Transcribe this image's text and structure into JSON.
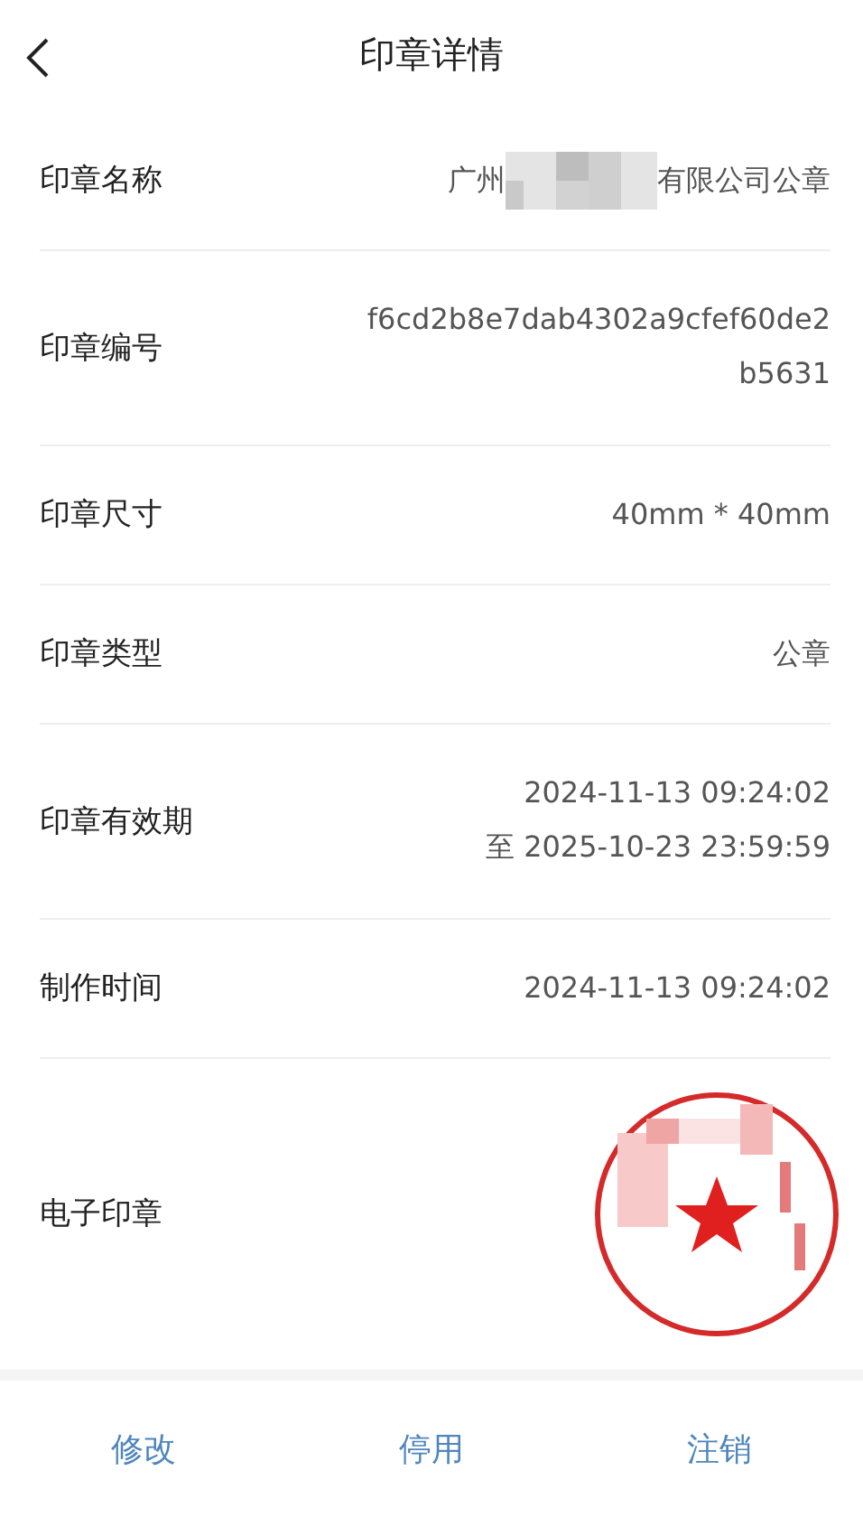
{
  "header": {
    "title": "印章详情"
  },
  "rows": [
    {
      "kind": "name",
      "label": "印章名称",
      "value_start": "广州",
      "value_end": "有限公司公章"
    },
    {
      "kind": "text",
      "label": "印章编号",
      "value": "f6cd2b8e7dab4302a9cfef60de2b5631"
    },
    {
      "kind": "text",
      "label": "印章尺寸",
      "value": "40mm * 40mm"
    },
    {
      "kind": "text",
      "label": "印章类型",
      "value": "公章"
    },
    {
      "kind": "lines",
      "label": "印章有效期",
      "lines": [
        "2024-11-13 09:24:02",
        "至 2025-10-23 23:59:59"
      ]
    },
    {
      "kind": "text",
      "label": "制作时间",
      "value": "2024-11-13 09:24:02"
    },
    {
      "kind": "seal",
      "label": "电子印章"
    }
  ],
  "actions": [
    "修改",
    "停用",
    "注销"
  ]
}
